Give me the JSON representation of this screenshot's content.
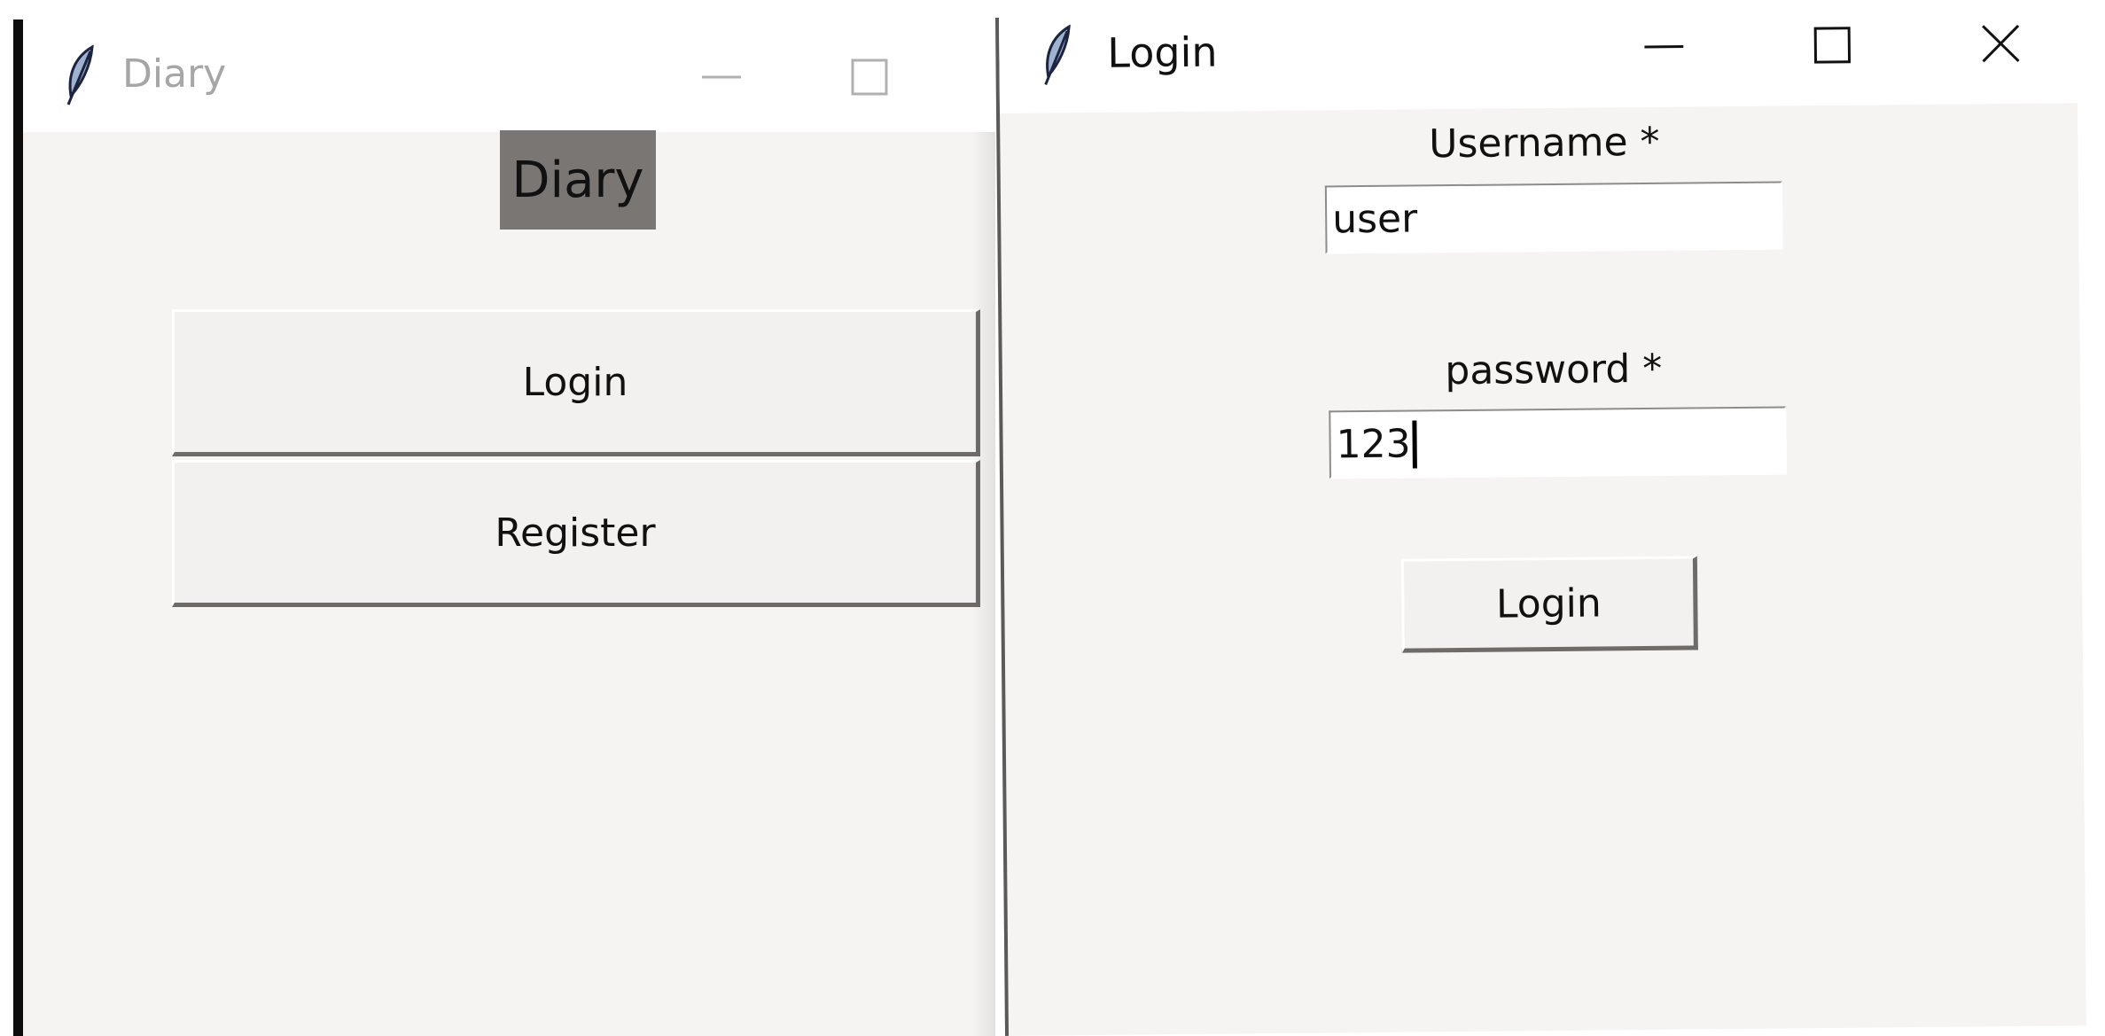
{
  "diary_window": {
    "title": "Diary",
    "heading": "Diary",
    "login_button": "Login",
    "register_button": "Register"
  },
  "login_window": {
    "title": "Login",
    "username_label": "Username *",
    "username_value": "user",
    "password_label": "password *",
    "password_value": "123",
    "login_button": "Login"
  },
  "icons": {
    "app_icon": "feather-icon",
    "minimize": "minimize-icon",
    "maximize": "maximize-icon",
    "close": "close-icon"
  },
  "colors": {
    "heading_bg": "#7a7674",
    "window_bg": "#f5f4f3",
    "titlebar_bg": "#ffffff"
  }
}
